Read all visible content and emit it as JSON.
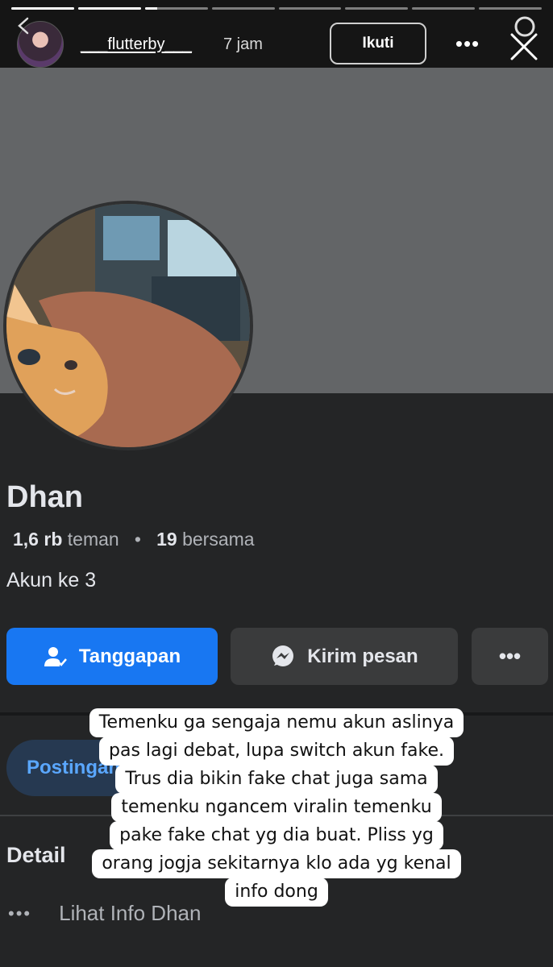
{
  "story": {
    "username": "___flutterby___",
    "time": "7 jam",
    "follow_label": "Ikuti",
    "progress": [
      1,
      1,
      0.2,
      0,
      0,
      0,
      0,
      0
    ]
  },
  "profile": {
    "name": "Dhan",
    "friends_count": "1,6 rb",
    "friends_label": "teman",
    "mutual_count": "19",
    "mutual_label": "bersama",
    "bio": "Akun ke 3"
  },
  "actions": {
    "respond": "Tanggapan",
    "message": "Kirim pesan"
  },
  "tabs": {
    "posts": "Postingan"
  },
  "details": {
    "title": "Detail",
    "see_info": "Lihat Info Dhan"
  },
  "caption": {
    "lines": [
      "Temenku ga sengaja nemu akun aslinya",
      "pas lagi debat, lupa switch akun fake.",
      "Trus dia bikin fake chat juga sama",
      "temenku ngancem viralin temenku",
      "pake fake chat yg dia buat. Pliss yg",
      "orang jogja sekitarnya klo ada yg kenal",
      "info dong"
    ]
  },
  "colors": {
    "primary_button": "#1877f2",
    "secondary_button": "#3a3b3c",
    "background": "#242526",
    "cover": "#636567",
    "tab_active_bg": "#263951",
    "tab_active_text": "#5aa7ff"
  }
}
